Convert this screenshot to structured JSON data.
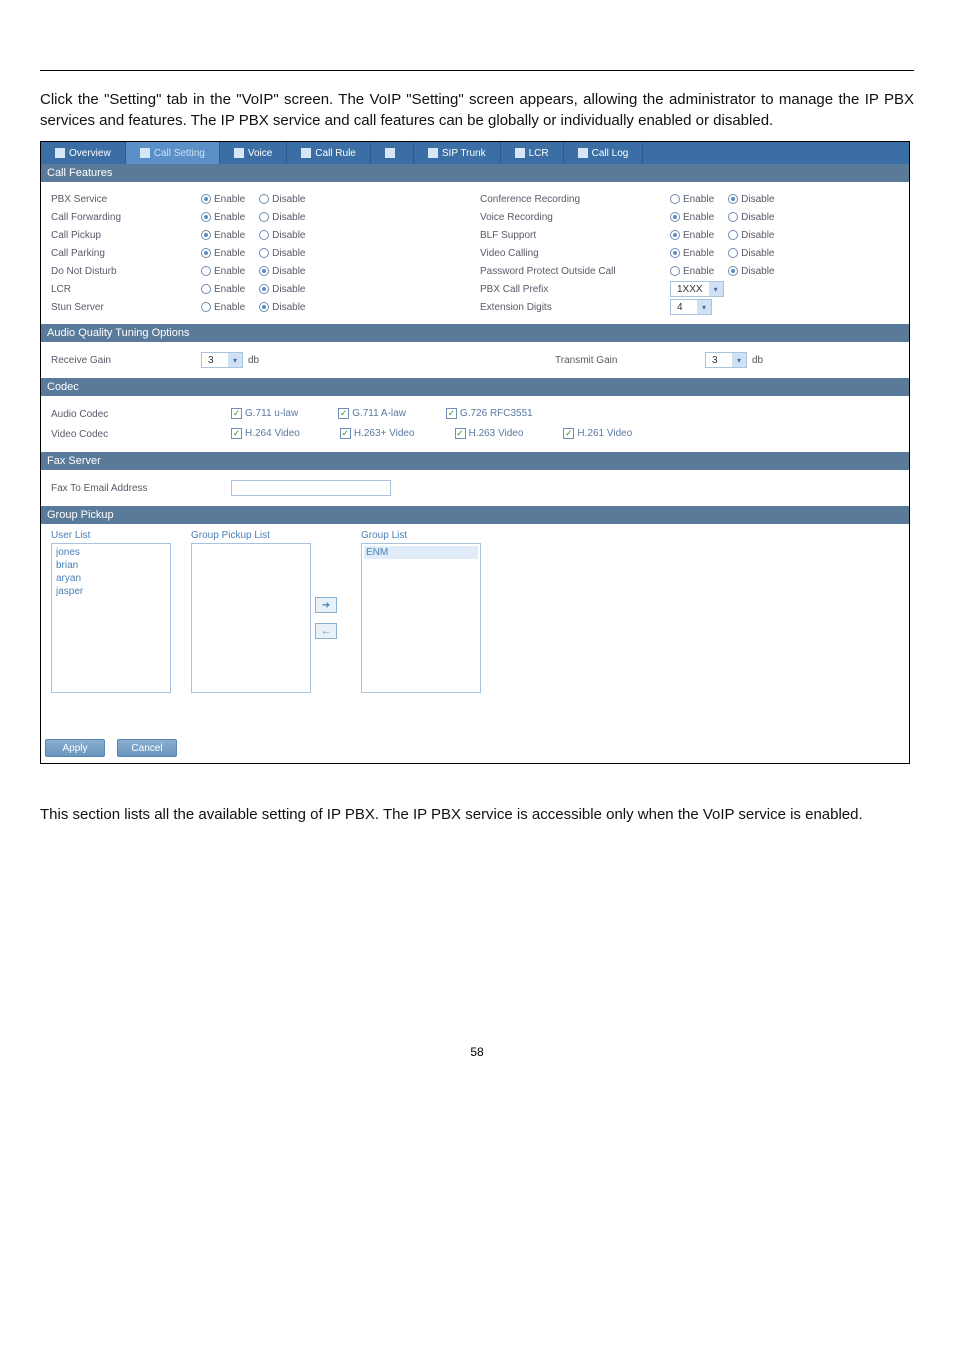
{
  "intro": "Click the \"Setting\" tab in the \"VoIP\" screen. The VoIP \"Setting\" screen appears, allowing the administrator to manage the IP PBX services and features. The IP PBX service and call features can be globally or individually enabled or disabled.",
  "tabs": {
    "overview": "Overview",
    "call_setting": "Call Setting",
    "voice": "Voice",
    "call_rule": "Call Rule",
    "sip_trunk_grey": "",
    "sip_trunk": "SIP Trunk",
    "lcr": "LCR",
    "call_log": "Call Log"
  },
  "sections": {
    "call_features": "Call Features",
    "audio_quality": "Audio Quality Tuning Options",
    "codec": "Codec",
    "fax_server": "Fax Server",
    "group_pickup": "Group Pickup"
  },
  "left_features": [
    {
      "label": "PBX Service",
      "enable": true
    },
    {
      "label": "Call Forwarding",
      "enable": true
    },
    {
      "label": "Call Pickup",
      "enable": true
    },
    {
      "label": "Call Parking",
      "enable": true
    },
    {
      "label": "Do Not Disturb",
      "enable": false
    },
    {
      "label": "LCR",
      "enable": false
    },
    {
      "label": "Stun Server",
      "enable": false
    }
  ],
  "right_features": [
    {
      "label": "Conference Recording",
      "type": "radio",
      "enable": false
    },
    {
      "label": "Voice Recording",
      "type": "radio",
      "enable": true
    },
    {
      "label": "BLF Support",
      "type": "radio",
      "enable": true
    },
    {
      "label": "Video Calling",
      "type": "radio",
      "enable": true
    },
    {
      "label": "Password Protect Outside Call",
      "type": "radio",
      "enable": false
    },
    {
      "label": "PBX Call Prefix",
      "type": "select",
      "value": "1XXX"
    },
    {
      "label": "Extension Digits",
      "type": "select",
      "value": "4"
    }
  ],
  "radio_labels": {
    "enable": "Enable",
    "disable": "Disable"
  },
  "gain": {
    "receive_label": "Receive Gain",
    "receive_value": "3",
    "transmit_label": "Transmit Gain",
    "transmit_value": "3",
    "unit": "db"
  },
  "codec": {
    "audio_label": "Audio Codec",
    "video_label": "Video Codec",
    "audio": [
      {
        "label": "G.711 u-law",
        "checked": true
      },
      {
        "label": "G.711 A-law",
        "checked": true
      },
      {
        "label": "G.726 RFC3551",
        "checked": true
      }
    ],
    "video": [
      {
        "label": "H.264 Video",
        "checked": true
      },
      {
        "label": "H.263+ Video",
        "checked": true
      },
      {
        "label": "H.263 Video",
        "checked": true
      },
      {
        "label": "H.261 Video",
        "checked": true
      }
    ]
  },
  "fax": {
    "label": "Fax To Email Address",
    "value": ""
  },
  "group_pickup": {
    "user_list_header": "User List",
    "group_pickup_list_header": "Group Pickup List",
    "group_list_header": "Group List",
    "users": [
      "jones",
      "brian",
      "aryan",
      "jasper"
    ],
    "groups": [
      "ENM"
    ]
  },
  "buttons": {
    "apply": "Apply",
    "cancel": "Cancel"
  },
  "outro": "This section lists all the available setting of IP PBX. The IP PBX service is accessible only when the VoIP service is enabled.",
  "page_number": "58"
}
